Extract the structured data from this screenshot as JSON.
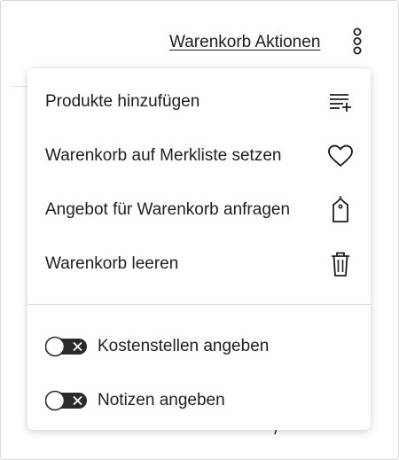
{
  "header": {
    "actions_link": "Warenkorb Aktionen",
    "more_icon": "kebab-vertical-icon"
  },
  "menu": {
    "items": [
      {
        "label": "Produkte hinzufügen",
        "icon": "add-to-list-icon"
      },
      {
        "label": "Warenkorb auf Merkliste setzen",
        "icon": "heart-icon"
      },
      {
        "label": "Angebot für Warenkorb anfragen",
        "icon": "price-tag-icon"
      },
      {
        "label": "Warenkorb leeren",
        "icon": "trash-icon"
      }
    ],
    "toggles": [
      {
        "label": "Kostenstellen angeben",
        "state": "off"
      },
      {
        "label": "Notizen angeben",
        "state": "off"
      }
    ]
  },
  "colors": {
    "text": "#1e1e1e",
    "divider": "#dcdcdc",
    "toggle_track": "#2a2a2a",
    "background": "#ffffff"
  }
}
